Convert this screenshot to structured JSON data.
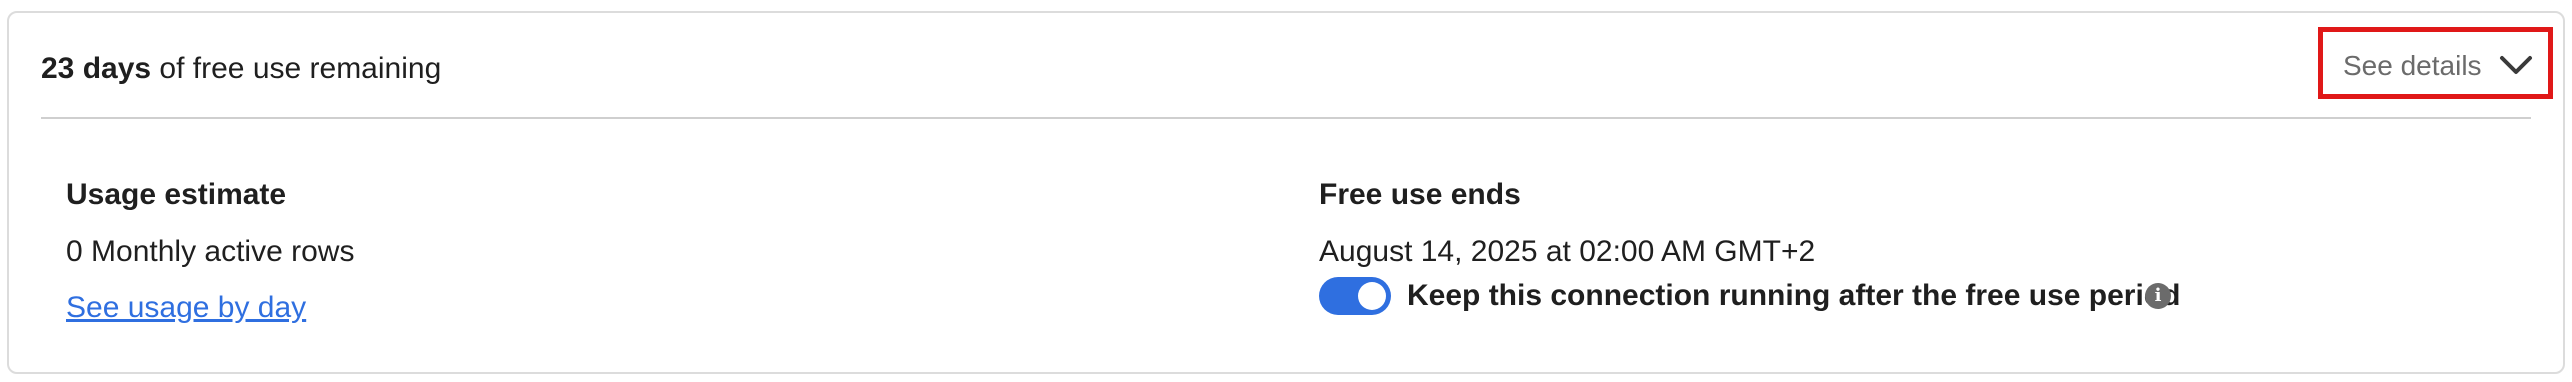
{
  "header": {
    "days_bold": "23 days",
    "days_rest": " of free use remaining",
    "details_label": "See details",
    "details_icon": "chevron-down-icon"
  },
  "usage": {
    "title": "Usage estimate",
    "value": "0 Monthly active rows",
    "link": "See usage by day"
  },
  "free_use": {
    "title": "Free use ends",
    "date": "August 14, 2025 at 02:00 AM GMT+2",
    "toggle_label": "Keep this connection running after the free use period",
    "toggle_on": true,
    "info_icon": "info-icon"
  },
  "colors": {
    "accent": "#2f6fe0",
    "highlight_box": "#e01818",
    "muted": "#6b6b6b"
  }
}
